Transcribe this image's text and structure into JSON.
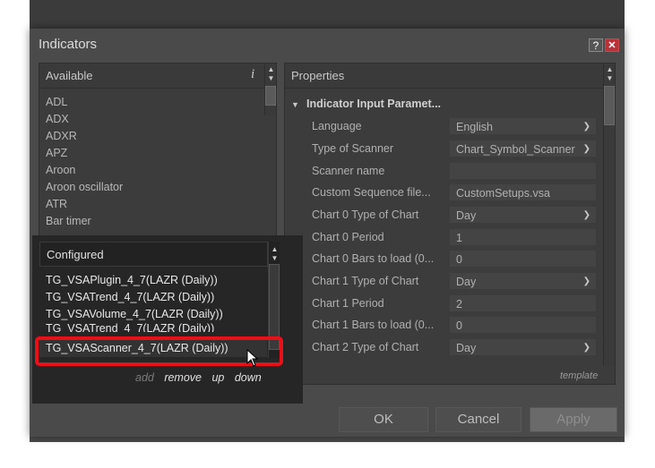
{
  "dialog": {
    "title": "Indicators",
    "help_label": "?",
    "close_label": "✕"
  },
  "available": {
    "header": "Available",
    "info_label": "i",
    "items": [
      "ADL",
      "ADX",
      "ADXR",
      "APZ",
      "Aroon",
      "Aroon oscillator",
      "ATR",
      "Bar timer"
    ]
  },
  "configured": {
    "header": "Configured",
    "items": [
      "TG_VSAPlugin_4_7(LAZR (Daily))",
      "TG_VSATrend_4_7(LAZR (Daily))",
      "TG_VSAVolume_4_7(LAZR (Daily))",
      "TG_VSATrend_4_7(LAZR (Daily))",
      "TG_VSAScanner_4_7(LAZR (Daily))"
    ],
    "selected_index": 4,
    "actions": {
      "add": "add",
      "remove": "remove",
      "up": "up",
      "down": "down"
    }
  },
  "properties": {
    "header": "Properties",
    "section": "Indicator Input Paramet...",
    "rows": [
      {
        "label": "Language",
        "value": "English",
        "dropdown": true
      },
      {
        "label": "Type of Scanner",
        "value": "Chart_Symbol_Scanner",
        "dropdown": true
      },
      {
        "label": "Scanner name",
        "value": "",
        "dropdown": false
      },
      {
        "label": "Custom Sequence file...",
        "value": "CustomSetups.vsa",
        "dropdown": false
      },
      {
        "label": "Chart 0 Type of Chart",
        "value": "Day",
        "dropdown": true
      },
      {
        "label": "Chart 0 Period",
        "value": "1",
        "dropdown": false
      },
      {
        "label": "Chart 0 Bars to load (0...",
        "value": "0",
        "dropdown": false
      },
      {
        "label": "Chart 1 Type of Chart",
        "value": "Day",
        "dropdown": true
      },
      {
        "label": "Chart 1 Period",
        "value": "2",
        "dropdown": false
      },
      {
        "label": "Chart 1 Bars to load (0...",
        "value": "0",
        "dropdown": false
      },
      {
        "label": "Chart 2 Type of Chart",
        "value": "Day",
        "dropdown": true
      }
    ],
    "template_label": "template"
  },
  "footer": {
    "ok_label": "OK",
    "cancel_label": "Cancel",
    "apply_label": "Apply"
  },
  "colors": {
    "highlight": "#e8111a"
  }
}
